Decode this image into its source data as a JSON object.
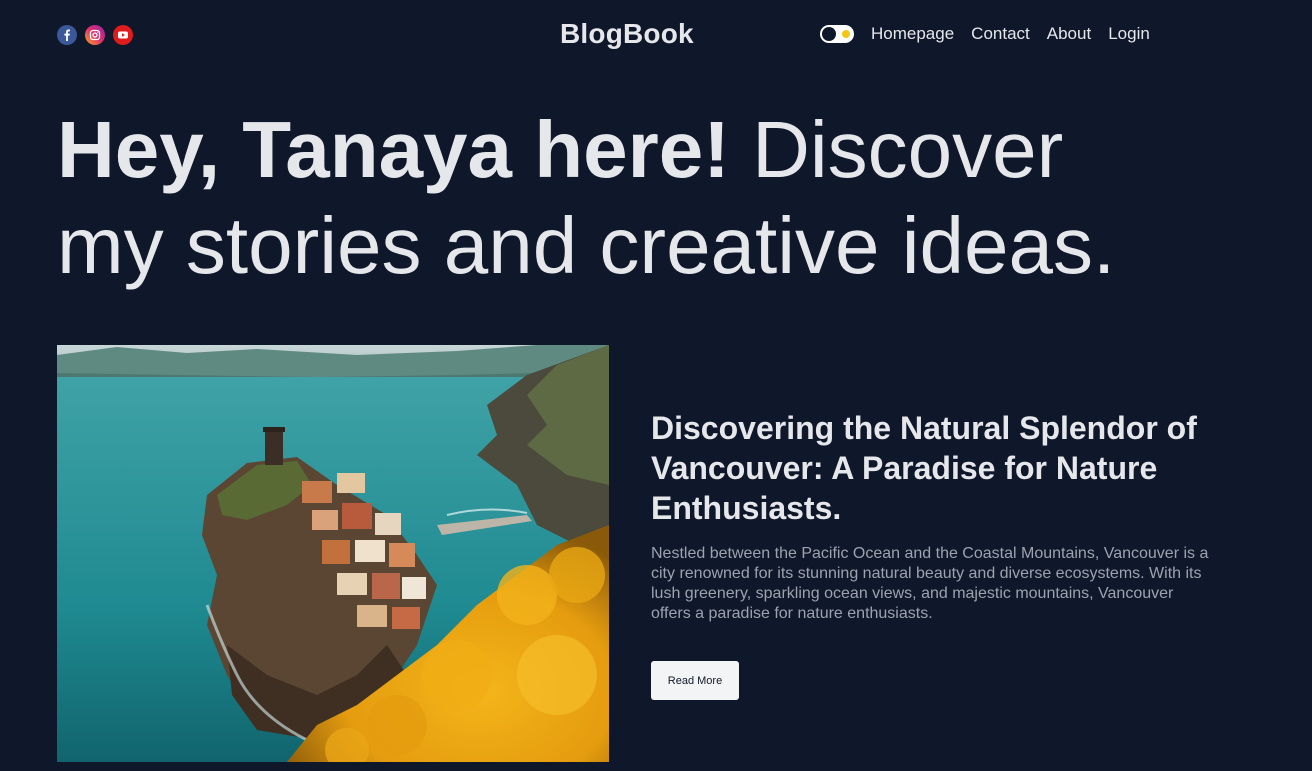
{
  "header": {
    "brand": "BlogBook",
    "social": [
      {
        "icon": "facebook-icon",
        "color": "#1877f2"
      },
      {
        "icon": "instagram-icon",
        "color": "#e1306c"
      },
      {
        "icon": "youtube-icon",
        "color": "#ff0000"
      }
    ],
    "theme_toggle": {
      "icon": "sun-icon",
      "state": "dark"
    },
    "nav": {
      "homepage": "Homepage",
      "contact": "Contact",
      "about": "About",
      "login": "Login"
    }
  },
  "hero": {
    "strong": "Hey, Tanaya here!",
    "light_line1": "Discover",
    "light_line2": "my stories and creative ideas."
  },
  "featured_post": {
    "image": "coastal-village-photo",
    "title": "Discovering the Natural Splendor of Vancouver: A Paradise for Nature Enthusiasts.",
    "excerpt": "Nestled between the Pacific Ocean and the Coastal Mountains, Vancouver is a city renowned for its stunning natural beauty and diverse ecosystems. With its lush greenery, sparkling ocean views, and majestic mountains, Vancouver offers a paradise for nature enthusiasts.",
    "read_more": "Read More"
  },
  "colors": {
    "background": "#0f172a",
    "text": "#e5e7eb",
    "muted": "#9ca3af",
    "button_bg": "#f3f4f6"
  }
}
